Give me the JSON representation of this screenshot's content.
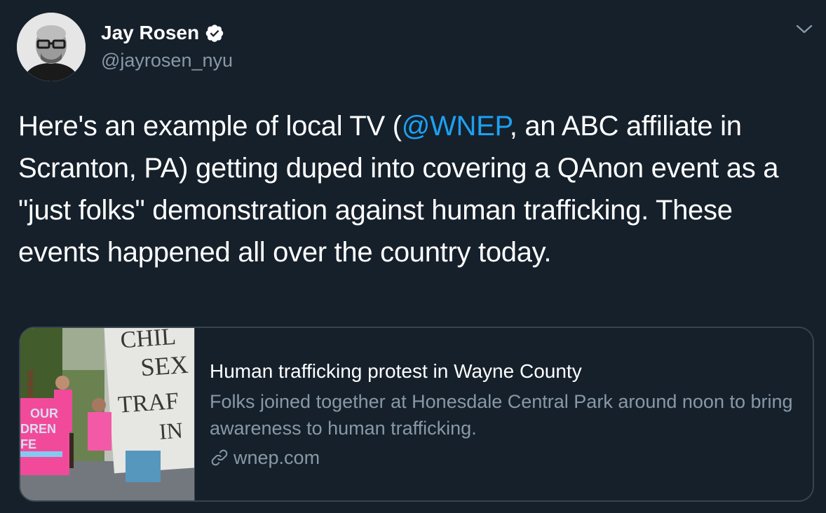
{
  "author": {
    "name": "Jay Rosen",
    "handle": "@jayrosen_nyu",
    "verified": true
  },
  "tweet": {
    "text_before_mention": "Here's an example of local TV (",
    "mention": "@WNEP",
    "text_after_mention": ", an ABC affiliate in Scranton, PA) getting duped into covering a QAnon event as a \"just folks\" demonstration against human trafficking. These events happened all over the country today."
  },
  "card": {
    "title": "Human trafficking protest in Wayne County",
    "description": "Folks joined together at Honesdale Central Park around noon to bring awareness to human trafficking.",
    "domain": "wnep.com",
    "image_sign_text": [
      "CHIL",
      "SEX",
      "TRAF",
      "IN"
    ],
    "image_pink_sign_text": [
      "OUR",
      "DREN",
      "FE"
    ]
  },
  "colors": {
    "background": "#15202b",
    "text": "#ffffff",
    "secondary_text": "#8899a6",
    "accent": "#1da1f2",
    "border": "#38444d"
  },
  "icons": {
    "verified": "verified-badge-icon",
    "caret": "chevron-down-icon",
    "link": "link-icon"
  }
}
